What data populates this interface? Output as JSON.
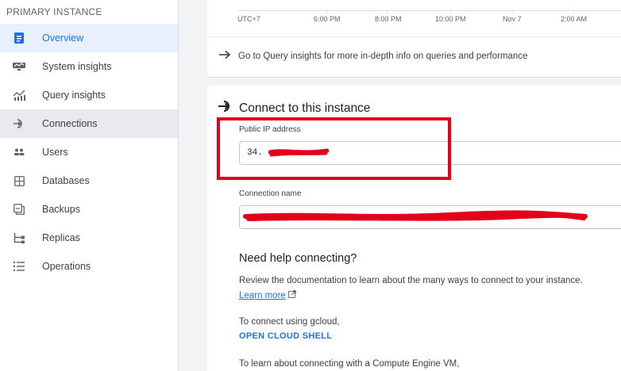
{
  "sidebar": {
    "title": "PRIMARY INSTANCE",
    "items": [
      {
        "label": "Overview",
        "icon": "overview-icon"
      },
      {
        "label": "System insights",
        "icon": "system-insights-icon"
      },
      {
        "label": "Query insights",
        "icon": "query-insights-icon"
      },
      {
        "label": "Connections",
        "icon": "connections-icon"
      },
      {
        "label": "Users",
        "icon": "users-icon"
      },
      {
        "label": "Databases",
        "icon": "databases-icon"
      },
      {
        "label": "Backups",
        "icon": "backups-icon"
      },
      {
        "label": "Replicas",
        "icon": "replicas-icon"
      },
      {
        "label": "Operations",
        "icon": "operations-icon"
      }
    ],
    "active_item": "Overview",
    "hover_item": "Connections"
  },
  "timeline": {
    "labels": [
      "UTC+7",
      "6:00 PM",
      "8:00 PM",
      "10:00 PM",
      "Nov 7",
      "2:00 AM"
    ]
  },
  "query_insights_link": {
    "text": "Go to Query insights for more in-depth info on queries and performance"
  },
  "connect": {
    "title": "Connect to this instance",
    "public_ip_label": "Public IP address",
    "public_ip_value": "34.",
    "connection_name_label": "Connection name",
    "connection_name_value": ""
  },
  "help": {
    "title": "Need help connecting?",
    "review_text": "Review the documentation to learn about the many ways to connect to your instance.",
    "learn_more": "Learn more",
    "gcloud_text": "To connect using gcloud,",
    "cloud_shell": "OPEN CLOUD SHELL",
    "vm_text": "To learn about connecting with a Compute Engine VM,"
  },
  "colors": {
    "accent": "#1a73e8",
    "annotation_red": "#e3001b"
  }
}
